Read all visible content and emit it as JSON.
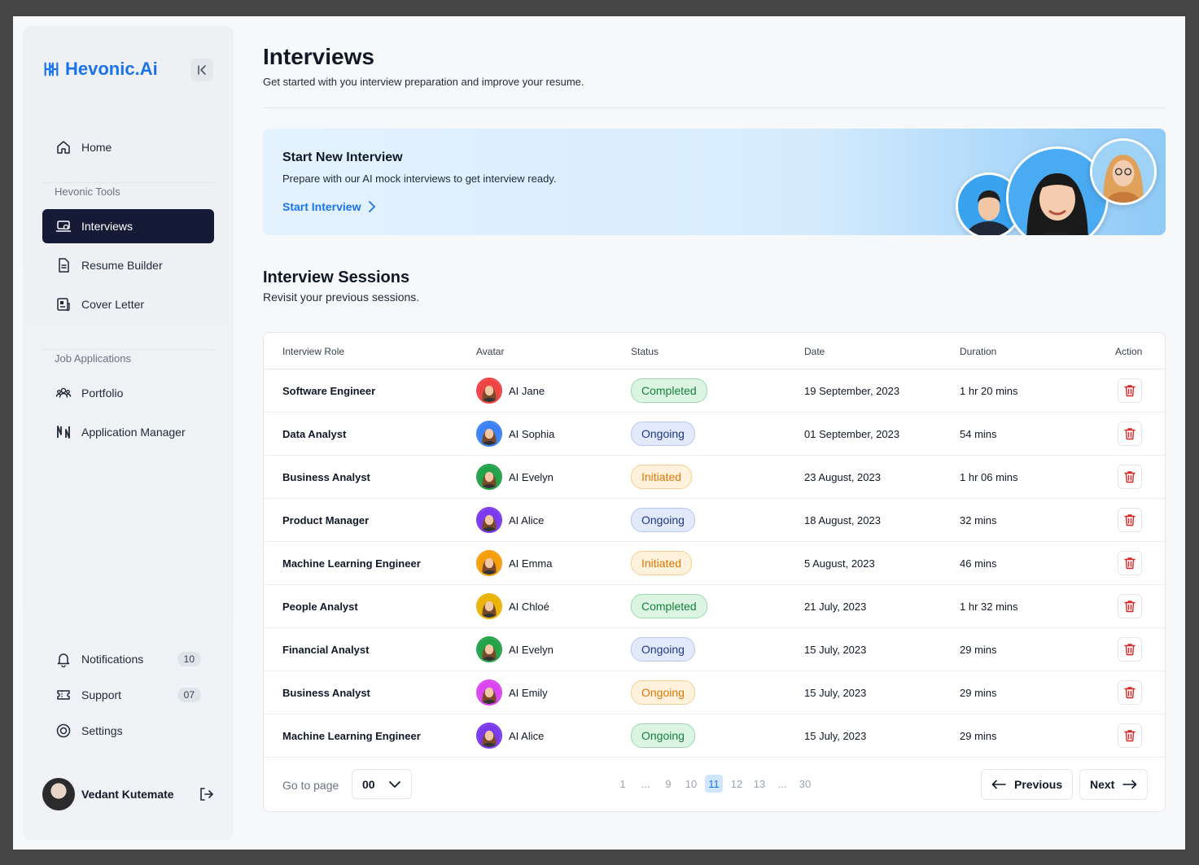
{
  "brand": {
    "name": "Hevonic.Ai",
    "accent": "#1a74e8"
  },
  "sidebar": {
    "home": "Home",
    "group_tools": "Hevonic Tools",
    "tools": [
      {
        "label": "Interviews",
        "icon": "laptop-icon",
        "active": true
      },
      {
        "label": "Resume Builder",
        "icon": "document-icon"
      },
      {
        "label": "Cover Letter",
        "icon": "newspaper-icon"
      }
    ],
    "group_jobs": "Job Applications",
    "jobs": [
      {
        "label": "Portfolio",
        "icon": "users-icon"
      },
      {
        "label": "Application Manager",
        "icon": "n-logo-icon"
      }
    ],
    "bottom": [
      {
        "label": "Notifications",
        "icon": "bell-icon",
        "badge": "10"
      },
      {
        "label": "Support",
        "icon": "ticket-icon",
        "badge": "07"
      },
      {
        "label": "Settings",
        "icon": "gear-icon"
      }
    ],
    "user": {
      "name": "Vedant Kutemate"
    }
  },
  "page": {
    "title": "Interviews",
    "subtitle": "Get started with you interview preparation and improve your resume."
  },
  "banner": {
    "title": "Start New Interview",
    "text": "Prepare with our AI mock interviews to get interview ready.",
    "cta": "Start Interview"
  },
  "sessions": {
    "title": "Interview Sessions",
    "subtitle": "Revisit your previous sessions.",
    "columns": [
      "Interview Role",
      "Avatar",
      "Status",
      "Date",
      "Duration",
      "Action"
    ],
    "rows": [
      {
        "role": "Software Engineer",
        "avatar": "AI Jane",
        "avatar_color": "#ef4444",
        "status": "Completed",
        "status_type": "completed",
        "date": "19 September, 2023",
        "duration": "1 hr 20 mins"
      },
      {
        "role": "Data Analyst",
        "avatar": "AI Sophia",
        "avatar_color": "#3b82f6",
        "status": "Ongoing",
        "status_type": "ongoing",
        "date": "01 September, 2023",
        "duration": "54 mins"
      },
      {
        "role": "Business Analyst",
        "avatar": "AI Evelyn",
        "avatar_color": "#22a34a",
        "status": "Initiated",
        "status_type": "initiated",
        "date": "23 August, 2023",
        "duration": "1 hr 06 mins"
      },
      {
        "role": "Product Manager",
        "avatar": "AI Alice",
        "avatar_color": "#7c3aed",
        "status": "Ongoing",
        "status_type": "ongoing",
        "date": "18 August, 2023",
        "duration": "32 mins"
      },
      {
        "role": "Machine Learning Engineer",
        "avatar": "AI Emma",
        "avatar_color": "#f59e0b",
        "status": "Initiated",
        "status_type": "initiated",
        "date": "5 August, 2023",
        "duration": "46 mins"
      },
      {
        "role": "People Analyst",
        "avatar": "AI Chloé",
        "avatar_color": "#eab308",
        "status": "Completed",
        "status_type": "completed",
        "date": "21 July, 2023",
        "duration": "1 hr 32 mins"
      },
      {
        "role": "Financial Analyst",
        "avatar": "AI Evelyn",
        "avatar_color": "#22a34a",
        "status": "Ongoing",
        "status_type": "ongoing",
        "date": "15 July, 2023",
        "duration": "29 mins"
      },
      {
        "role": "Business Analyst",
        "avatar": "AI Emily",
        "avatar_color": "#d946ef",
        "status": "Ongoing",
        "status_type": "initiated",
        "date": "15 July, 2023",
        "duration": "29 mins"
      },
      {
        "role": "Machine Learning Engineer",
        "avatar": "AI Alice",
        "avatar_color": "#7c3aed",
        "status": "Ongoing",
        "status_type": "completed",
        "date": "15 July, 2023",
        "duration": "29 mins"
      }
    ]
  },
  "pagination": {
    "goto_label": "Go to page",
    "goto_value": "00",
    "pages": [
      "1",
      "...",
      "9",
      "10",
      "11",
      "12",
      "13",
      "...",
      "30"
    ],
    "current": "11",
    "previous": "Previous",
    "next": "Next"
  }
}
